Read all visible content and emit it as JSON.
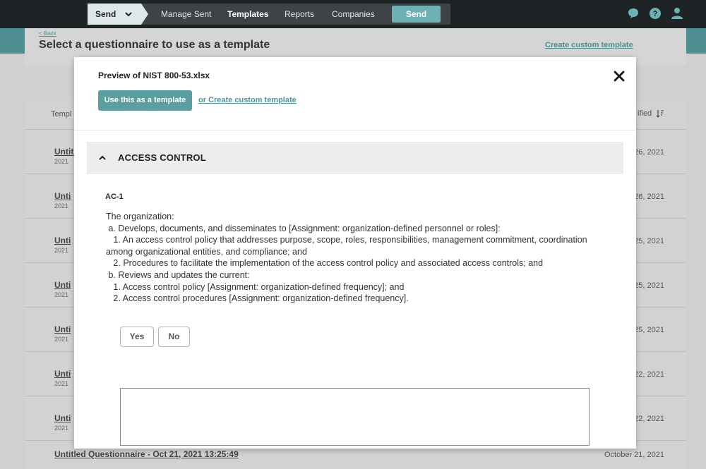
{
  "nav": {
    "send_dropdown": "Send",
    "links": [
      "Manage Sent",
      "Templates",
      "Reports",
      "Companies"
    ],
    "send_button": "Send",
    "icons": [
      "chat-icon",
      "help-icon",
      "user-icon"
    ]
  },
  "page": {
    "back": "< Back",
    "title": "Select a questionnaire to use as a template",
    "create_custom_link": "Create custom template"
  },
  "table": {
    "header_left": "Templ",
    "header_right": "ified",
    "rows": [
      {
        "name": "Untitl",
        "year": "2021",
        "date": "26, 2021"
      },
      {
        "name": "Unti",
        "year": "2021",
        "date": "26, 2021"
      },
      {
        "name": "Unti",
        "year": "2021",
        "date": "25, 2021"
      },
      {
        "name": "Unti",
        "year": "2021",
        "date": "25, 2021"
      },
      {
        "name": "Unti",
        "year": "2021",
        "date": "25, 2021"
      },
      {
        "name": "Unti",
        "year": "2021",
        "date": "22, 2021"
      },
      {
        "name": "Unti",
        "year": "2021",
        "date": "22, 2021"
      }
    ],
    "last_row": {
      "name": "Untitled Questionnaire - Oct 21, 2021 13:25:49",
      "date": "October 21, 2021"
    }
  },
  "modal": {
    "title": "Preview of NIST 800-53.xlsx",
    "use_button": "Use this as a template",
    "or_create": "or Create custom template",
    "section_title": "ACCESS CONTROL",
    "control_id": "AC-1",
    "lines": [
      "The organization:",
      " a. Develops, documents, and disseminates to [Assignment: organization-defined personnel or roles]:",
      "   1. An access control policy that addresses purpose, scope, roles, responsibilities, management commitment, coordination among organizational entities, and compliance; and",
      "   2. Procedures to facilitate the implementation of the access control policy and associated access controls; and",
      " b. Reviews and updates the current:",
      "   1. Access control policy [Assignment: organization-defined frequency]; and",
      "   2. Access control procedures [Assignment: organization-defined frequency]."
    ],
    "yes": "Yes",
    "no": "No"
  },
  "colors": {
    "topbar": "#1e2326",
    "accent": "#5b9ea1",
    "nav_send": "#6cb1b4"
  }
}
